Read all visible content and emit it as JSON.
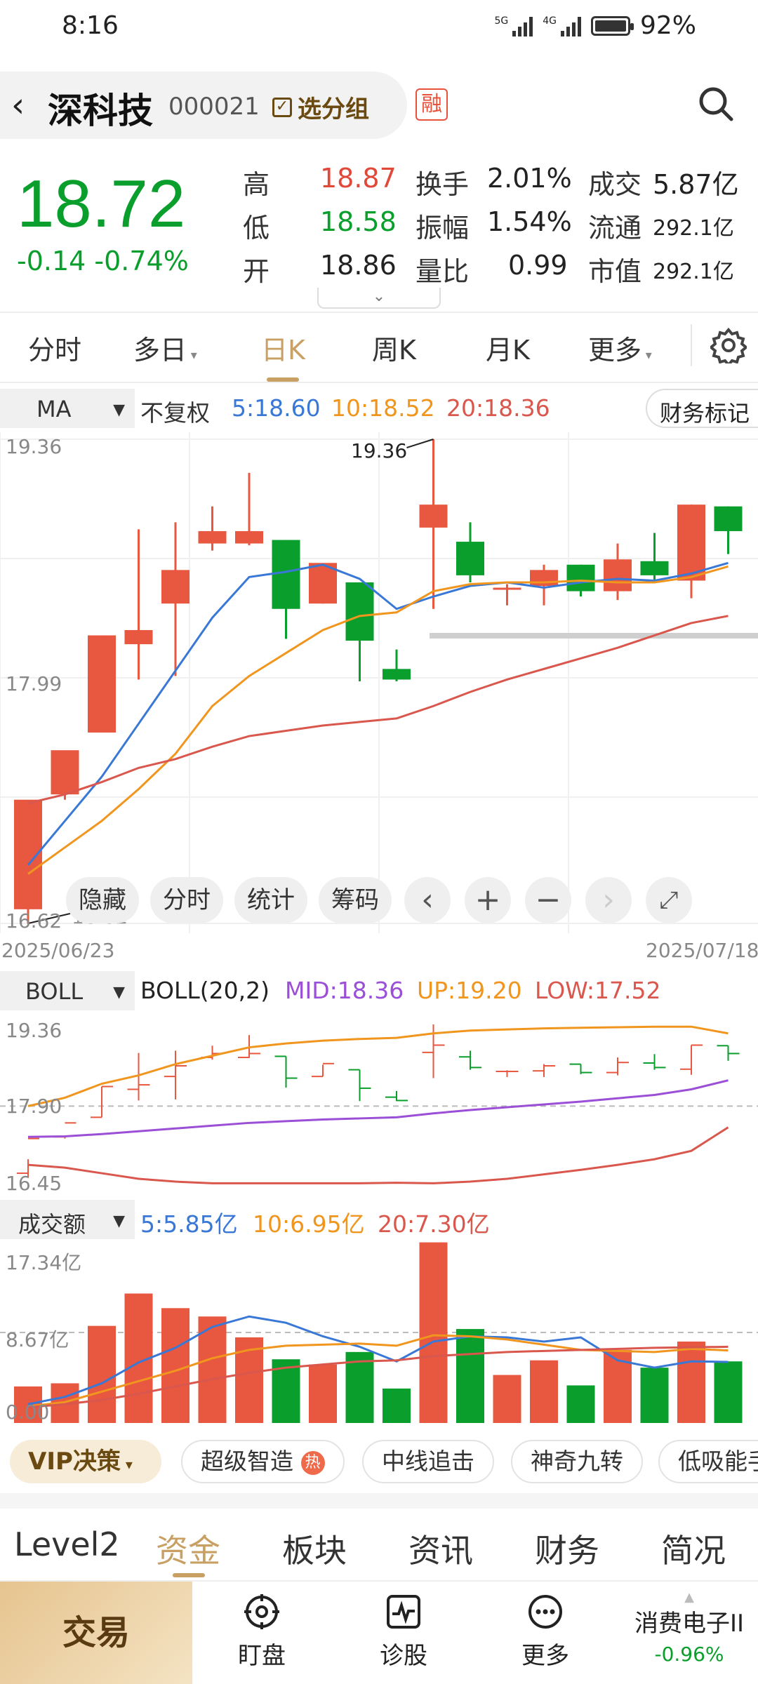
{
  "status_bar": {
    "time": "8:16",
    "net1": "5G",
    "net2": "4G",
    "battery": "92%"
  },
  "header": {
    "stock_name": "深科技",
    "stock_code": "000021",
    "group_button": "选分组",
    "margin_badge": "融"
  },
  "quote": {
    "price": "18.72",
    "change": "-0.14",
    "change_pct": "-0.74%",
    "high_label": "高",
    "high": "18.87",
    "low_label": "低",
    "low": "18.58",
    "open_label": "开",
    "open": "18.86",
    "turnover_label": "换手",
    "turnover": "2.01%",
    "amplitude_label": "振幅",
    "amplitude": "1.54%",
    "vol_ratio_label": "量比",
    "vol_ratio": "0.99",
    "amount_label": "成交",
    "amount": "5.87亿",
    "float_label": "流通",
    "float_cap": "292.1亿",
    "mcap_label": "市值",
    "market_cap": "292.1亿"
  },
  "period_tabs": [
    "分时",
    "多日",
    "日K",
    "周K",
    "月K",
    "更多"
  ],
  "active_period": "日K",
  "ma_bar": {
    "indicator": "MA",
    "adjust": "不复权",
    "ma5": "5:18.60",
    "ma10": "10:18.52",
    "ma20": "20:18.36",
    "finance_marker": "财务标记"
  },
  "kline_axis": {
    "top": "19.36",
    "mid": "17.99",
    "bottom": "16.62",
    "peak_label": "19.36",
    "low_label": "16.62"
  },
  "dates": {
    "start": "2025/06/23",
    "end": "2025/07/18"
  },
  "chart_tools": {
    "hide": "隐藏",
    "intraday": "分时",
    "stats": "统计",
    "chips": "筹码"
  },
  "boll_bar": {
    "indicator": "BOLL",
    "params": "BOLL(20,2)",
    "mid": "MID:18.36",
    "up": "UP:19.20",
    "low": "LOW:17.52",
    "axis_top": "19.36",
    "axis_mid": "17.90",
    "axis_bottom": "16.45"
  },
  "volume_bar": {
    "indicator": "成交额",
    "ma5": "5:5.85亿",
    "ma10": "10:6.95亿",
    "ma20": "20:7.30亿",
    "axis_top": "17.34亿",
    "axis_mid": "8.67亿",
    "axis_bottom": "0.00"
  },
  "strategy": {
    "vip": "VIP决策",
    "chips": [
      "超级智造",
      "中线追击",
      "神奇九转",
      "低吸能手"
    ],
    "hot": "热"
  },
  "info_tabs": [
    "Level2",
    "资金",
    "板块",
    "资讯",
    "财务",
    "简况"
  ],
  "active_info_tab": "资金",
  "nav": {
    "trade": "交易",
    "watch": "盯盘",
    "diagnose": "诊股",
    "more": "更多",
    "sector_name": "消费电子II",
    "sector_change": "-0.96%"
  },
  "colors": {
    "up": "#E8573F",
    "down": "#0A9E2C",
    "ma5": "#3A78D6",
    "ma10": "#F0961E",
    "ma20": "#D9574D",
    "boll_mid": "#9B4FD6",
    "accent": "#C9A063"
  },
  "chart_data": {
    "type": "candlestick",
    "x": [
      "2025/06/23",
      "",
      "",
      "",
      "",
      "",
      "",
      "",
      "",
      "",
      "",
      "",
      "",
      "",
      "",
      "",
      "",
      "",
      "",
      "2025/07/18"
    ],
    "candles": [
      {
        "o": 16.7,
        "h": 16.95,
        "l": 16.62,
        "c": 17.32
      },
      {
        "o": 17.35,
        "h": 17.35,
        "l": 17.32,
        "c": 17.6
      },
      {
        "o": 17.7,
        "h": 18.25,
        "l": 17.7,
        "c": 18.25
      },
      {
        "o": 18.2,
        "h": 18.85,
        "l": 18.0,
        "c": 18.28
      },
      {
        "o": 18.43,
        "h": 18.89,
        "l": 18.02,
        "c": 18.62
      },
      {
        "o": 18.77,
        "h": 18.98,
        "l": 18.73,
        "c": 18.84
      },
      {
        "o": 18.77,
        "h": 19.17,
        "l": 18.76,
        "c": 18.84
      },
      {
        "o": 18.79,
        "h": 18.79,
        "l": 18.23,
        "c": 18.4
      },
      {
        "o": 18.43,
        "h": 18.64,
        "l": 18.43,
        "c": 18.66
      },
      {
        "o": 18.55,
        "h": 18.55,
        "l": 17.99,
        "c": 18.22
      },
      {
        "o": 18.06,
        "h": 18.17,
        "l": 17.99,
        "c": 18.0
      },
      {
        "o": 18.86,
        "h": 19.36,
        "l": 18.4,
        "c": 18.99
      },
      {
        "o": 18.78,
        "h": 18.89,
        "l": 18.55,
        "c": 18.59
      },
      {
        "o": 18.52,
        "h": 18.54,
        "l": 18.42,
        "c": 18.52
      },
      {
        "o": 18.53,
        "h": 18.65,
        "l": 18.42,
        "c": 18.62
      },
      {
        "o": 18.65,
        "h": 18.65,
        "l": 18.47,
        "c": 18.5
      },
      {
        "o": 18.5,
        "h": 18.77,
        "l": 18.45,
        "c": 18.68
      },
      {
        "o": 18.67,
        "h": 18.83,
        "l": 18.55,
        "c": 18.59
      },
      {
        "o": 18.56,
        "h": 18.99,
        "l": 18.46,
        "c": 18.99
      },
      {
        "o": 18.98,
        "h": 18.98,
        "l": 18.71,
        "c": 18.84
      }
    ],
    "ma5": [
      16.95,
      17.2,
      17.45,
      17.75,
      18.05,
      18.35,
      18.58,
      18.61,
      18.65,
      18.57,
      18.4,
      18.47,
      18.53,
      18.55,
      18.52,
      18.55,
      18.57,
      18.56,
      18.6,
      18.66
    ],
    "ma10": [
      16.9,
      17.05,
      17.2,
      17.38,
      17.58,
      17.85,
      18.02,
      18.15,
      18.28,
      18.36,
      18.38,
      18.5,
      18.54,
      18.55,
      18.55,
      18.56,
      18.55,
      18.55,
      18.58,
      18.64
    ],
    "ma20": [
      17.3,
      17.35,
      17.42,
      17.5,
      17.55,
      17.62,
      17.68,
      17.71,
      17.74,
      17.76,
      17.78,
      17.85,
      17.93,
      18.0,
      18.06,
      18.12,
      18.18,
      18.25,
      18.32,
      18.36
    ],
    "ylim": [
      16.62,
      19.36
    ],
    "boll": {
      "ylim": [
        16.45,
        19.36
      ],
      "up": [
        17.9,
        18.05,
        18.3,
        18.45,
        18.65,
        18.8,
        18.95,
        19.02,
        19.07,
        19.1,
        19.12,
        19.2,
        19.25,
        19.27,
        19.29,
        19.3,
        19.31,
        19.32,
        19.32,
        19.2
      ],
      "mid": [
        17.35,
        17.36,
        17.4,
        17.45,
        17.5,
        17.55,
        17.6,
        17.63,
        17.66,
        17.68,
        17.7,
        17.77,
        17.83,
        17.88,
        17.93,
        17.98,
        18.04,
        18.1,
        18.2,
        18.36
      ],
      "low": [
        16.85,
        16.8,
        16.7,
        16.6,
        16.55,
        16.52,
        16.52,
        16.52,
        16.52,
        16.52,
        16.53,
        16.52,
        16.55,
        16.6,
        16.68,
        16.76,
        16.85,
        16.95,
        17.1,
        17.52
      ]
    },
    "volume": {
      "unit": "亿",
      "ylim": [
        0,
        17.34
      ],
      "values": [
        3.5,
        3.8,
        9.3,
        12.4,
        11.0,
        10.2,
        8.2,
        6.1,
        5.6,
        6.8,
        3.3,
        17.3,
        9.0,
        4.6,
        6.0,
        3.6,
        7.0,
        5.3,
        7.8,
        5.9
      ],
      "ma5": [
        1.8,
        2.5,
        3.8,
        5.8,
        7.2,
        9.2,
        10.2,
        9.6,
        8.3,
        7.3,
        5.9,
        7.8,
        8.3,
        8.2,
        7.8,
        8.2,
        6.0,
        5.3,
        5.9,
        5.85
      ],
      "ma10": [
        1.6,
        2.0,
        3.0,
        4.0,
        5.0,
        6.2,
        7.0,
        7.4,
        7.5,
        7.6,
        7.4,
        8.4,
        8.3,
        8.0,
        7.5,
        7.0,
        6.9,
        6.8,
        7.1,
        6.95
      ],
      "ma20": [
        1.5,
        1.8,
        2.2,
        2.8,
        3.5,
        4.2,
        4.8,
        5.3,
        5.6,
        5.9,
        6.0,
        6.4,
        6.6,
        6.8,
        6.9,
        7.0,
        7.1,
        7.2,
        7.25,
        7.3
      ]
    }
  }
}
